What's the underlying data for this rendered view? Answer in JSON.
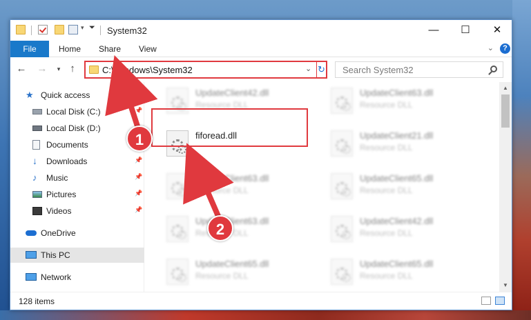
{
  "window": {
    "title": "System32"
  },
  "ribbon": {
    "tabs": [
      "File",
      "Home",
      "Share",
      "View"
    ]
  },
  "nav": {
    "address": "C:\\Windows\\System32",
    "search_placeholder": "Search System32"
  },
  "sidebar": {
    "items": [
      {
        "label": "Quick access",
        "icon": "star-icon"
      },
      {
        "label": "Local Disk (C:)",
        "icon": "drive-icon",
        "pinned": true
      },
      {
        "label": "Local Disk (D:)",
        "icon": "drive-icon"
      },
      {
        "label": "Documents",
        "icon": "documents-icon"
      },
      {
        "label": "Downloads",
        "icon": "download-icon",
        "pinned": true
      },
      {
        "label": "Music",
        "icon": "music-icon",
        "pinned": true
      },
      {
        "label": "Pictures",
        "icon": "pictures-icon",
        "pinned": true
      },
      {
        "label": "Videos",
        "icon": "videos-icon",
        "pinned": true
      },
      {
        "label": "OneDrive",
        "icon": "cloud-icon"
      },
      {
        "label": "This PC",
        "icon": "computer-icon",
        "selected": true
      },
      {
        "label": "Network",
        "icon": "network-icon"
      }
    ]
  },
  "files": [
    {
      "name": "UpdateClient42.dll",
      "type": "Resource DLL",
      "blurred": true
    },
    {
      "name": "UpdateClient63.dll",
      "type": "Resource DLL",
      "blurred": true
    },
    {
      "name": "fiforead.dll",
      "type": "",
      "blurred": false
    },
    {
      "name": "UpdateClient21.dll",
      "type": "Resource DLL",
      "blurred": true
    },
    {
      "name": "UpdateClient63.dll",
      "type": "Resource DLL",
      "blurred": true
    },
    {
      "name": "UpdateClient65.dll",
      "type": "Resource DLL",
      "blurred": true
    },
    {
      "name": "UpdateClient63.dll",
      "type": "Resource DLL",
      "blurred": true
    },
    {
      "name": "UpdateClient42.dll",
      "type": "Resource DLL",
      "blurred": true
    },
    {
      "name": "UpdateClient65.dll",
      "type": "Resource DLL",
      "blurred": true
    },
    {
      "name": "UpdateClient65.dll",
      "type": "Resource DLL",
      "blurred": true
    }
  ],
  "status": {
    "item_count": "128 items"
  },
  "annotations": {
    "step1": "1",
    "step2": "2",
    "color": "#e0393e"
  }
}
